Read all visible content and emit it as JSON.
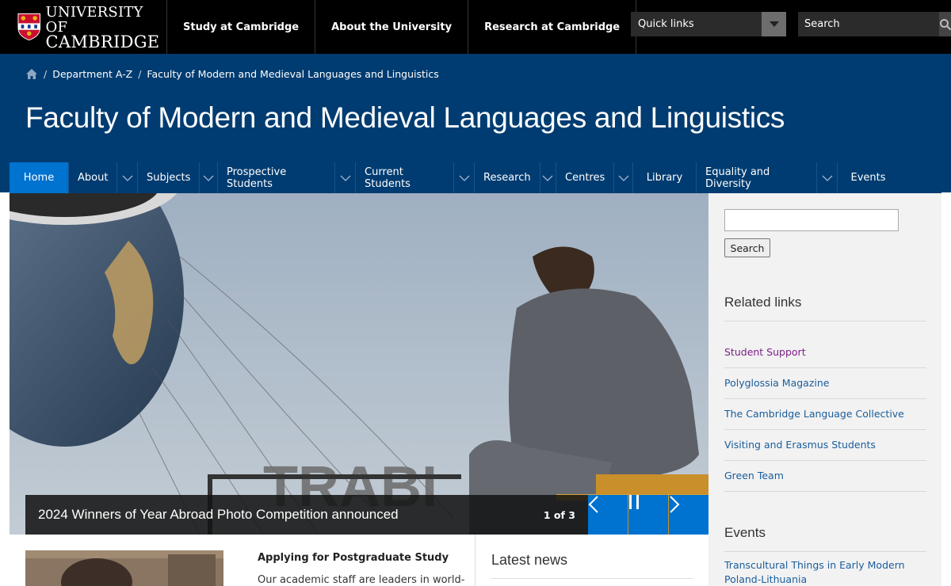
{
  "header": {
    "logo_line1": "UNIVERSITY OF",
    "logo_line2": "CAMBRIDGE",
    "nav": [
      "Study at Cambridge",
      "About the University",
      "Research at Cambridge"
    ],
    "quick_links": "Quick links",
    "search_placeholder": "Search"
  },
  "breadcrumb": [
    "Department A-Z",
    "Faculty of Modern and Medieval Languages and Linguistics"
  ],
  "page_title": "Faculty of Modern and Medieval Languages and Linguistics",
  "main_nav": [
    {
      "label": "Home",
      "active": true,
      "dropdown": false
    },
    {
      "label": "About",
      "active": false,
      "dropdown": true
    },
    {
      "label": "Subjects",
      "active": false,
      "dropdown": true
    },
    {
      "label": "Prospective Students",
      "active": false,
      "dropdown": true
    },
    {
      "label": "Current Students",
      "active": false,
      "dropdown": true
    },
    {
      "label": "Research",
      "active": false,
      "dropdown": true
    },
    {
      "label": "Centres",
      "active": false,
      "dropdown": true
    },
    {
      "label": "Library",
      "active": false,
      "dropdown": false
    },
    {
      "label": "Equality and Diversity",
      "active": false,
      "dropdown": true
    },
    {
      "label": "Events",
      "active": false,
      "dropdown": false
    }
  ],
  "carousel": {
    "caption": "2024 Winners of Year Abroad Photo Competition announced",
    "counter": "1 of 3",
    "sign_text": "TRABI"
  },
  "sidebar": {
    "search_button": "Search",
    "related_heading": "Related links",
    "related_links": [
      "Student Support",
      "Polyglossia Magazine",
      "The Cambridge Language Collective",
      "Visiting and Erasmus Students",
      "Green Team"
    ],
    "events_heading": "Events",
    "event_line1": "Transcultural Things in Early Modern",
    "event_line2": "Poland-Lithuania"
  },
  "content": {
    "postgrad_title": "Applying for Postgraduate Study",
    "postgrad_text": "Our academic staff are leaders in world-",
    "latest_news": "Latest news"
  },
  "colors": {
    "band": "#003c71",
    "active_nav": "#0072cf",
    "link": "#1a5d9b",
    "visited_link": "#7a1f86"
  }
}
